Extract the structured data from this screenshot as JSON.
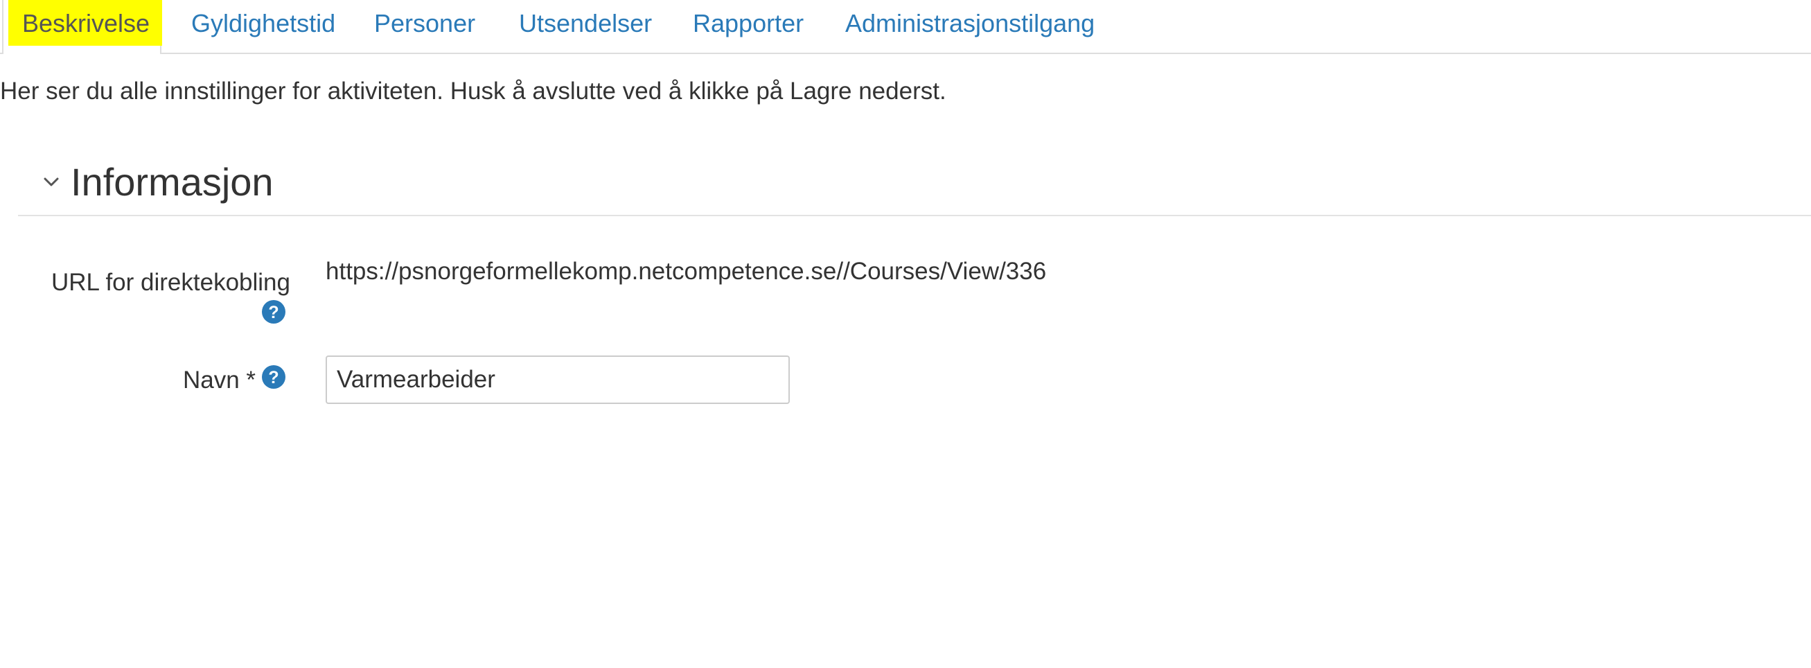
{
  "tabs": [
    {
      "label": "Beskrivelse",
      "active": true
    },
    {
      "label": "Gyldighetstid",
      "active": false
    },
    {
      "label": "Personer",
      "active": false
    },
    {
      "label": "Utsendelser",
      "active": false
    },
    {
      "label": "Rapporter",
      "active": false
    },
    {
      "label": "Administrasjonstilgang",
      "active": false
    }
  ],
  "intro_text": "Her ser du alle innstillinger for aktiviteten. Husk å avslutte ved å klikke på Lagre nederst.",
  "section": {
    "title": "Informasjon",
    "expanded": true,
    "icon": "chevron-down-icon"
  },
  "fields": {
    "direct_link": {
      "label": "URL for direktekobling",
      "value": "https://psnorgeformellekomp.netcompetence.se//Courses/View/336",
      "help_icon": "question-circle-icon"
    },
    "name": {
      "label": "Navn *",
      "value": "Varmearbeider",
      "help_icon": "question-circle-icon"
    }
  },
  "colors": {
    "tab_link": "#2a7ab8",
    "active_tab_highlight": "#ffff00",
    "help_icon": "#2a7ab8",
    "text": "#333333"
  }
}
